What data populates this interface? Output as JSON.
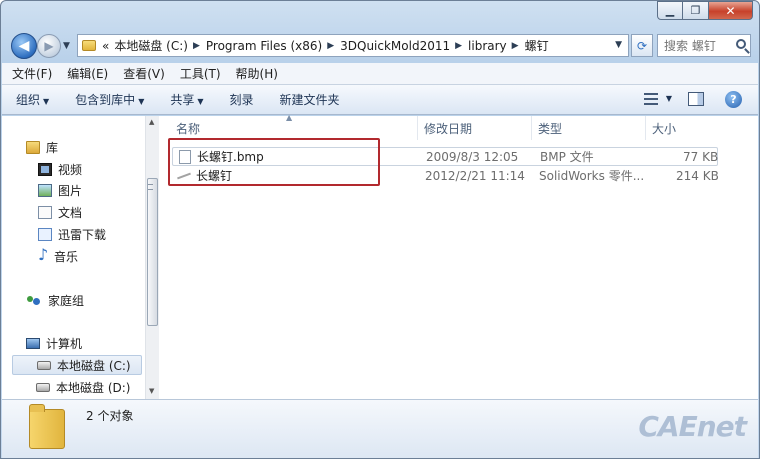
{
  "address": {
    "prefix": "«",
    "crumbs": [
      "本地磁盘 (C:)",
      "Program Files (x86)",
      "3DQuickMold2011",
      "library",
      "螺钉"
    ]
  },
  "search": {
    "placeholder": "搜索 螺钉"
  },
  "menu": [
    "文件(F)",
    "编辑(E)",
    "查看(V)",
    "工具(T)",
    "帮助(H)"
  ],
  "commands": [
    {
      "label": "组织",
      "dropdown": true
    },
    {
      "label": "包含到库中",
      "dropdown": true
    },
    {
      "label": "共享",
      "dropdown": true
    },
    {
      "label": "刻录",
      "dropdown": false
    },
    {
      "label": "新建文件夹",
      "dropdown": false
    }
  ],
  "nav": {
    "library": "库",
    "library_items": [
      "视频",
      "图片",
      "文档",
      "迅雷下载",
      "音乐"
    ],
    "homegroup": "家庭组",
    "computer": "计算机",
    "drives": [
      "本地磁盘 (C:)",
      "本地磁盘 (D:)"
    ]
  },
  "columns": {
    "name": "名称",
    "date": "修改日期",
    "type": "类型",
    "size": "大小"
  },
  "files": [
    {
      "name": "长螺钉.bmp",
      "date": "2009/8/3 12:05",
      "type": "BMP 文件",
      "size": "77 KB",
      "icon": "image-file-icon"
    },
    {
      "name": "长螺钉",
      "date": "2012/2/21 11:14",
      "type": "SolidWorks 零件...",
      "size": "214 KB",
      "icon": "solidworks-part-icon"
    }
  ],
  "details": {
    "count": "2 个对象"
  },
  "watermark": "CAEnet",
  "colors": {
    "highlight_box": "#b2292e",
    "accent": "#2f6fc0"
  }
}
